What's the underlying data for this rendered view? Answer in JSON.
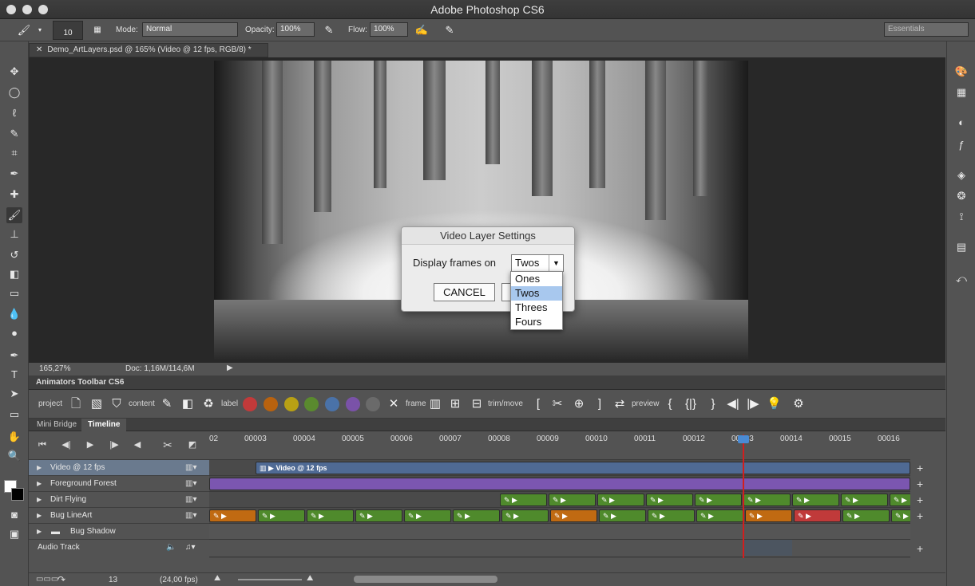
{
  "window": {
    "title": "Adobe Photoshop CS6"
  },
  "options": {
    "brush_size": "10",
    "mode_label": "Mode:",
    "mode_value": "Normal",
    "opacity_label": "Opacity:",
    "opacity_value": "100%",
    "flow_label": "Flow:",
    "flow_value": "100%",
    "workspace": "Essentials"
  },
  "document": {
    "tab_label": "Demo_ArtLayers.psd @ 165% (Video @ 12 fps, RGB/8) *",
    "zoom": "165,27%",
    "doc_size": "Doc: 1,16M/114,6M"
  },
  "dialog": {
    "title": "Video Layer Settings",
    "label": "Display frames on",
    "selected": "Twos",
    "cancel_label": "CANCEL",
    "options": [
      "Ones",
      "Twos",
      "Threes",
      "Fours"
    ]
  },
  "animators_toolbar": {
    "title": "Animators Toolbar CS6",
    "project_label": "project",
    "content_label": "content",
    "label_label": "label",
    "frame_label": "frame",
    "trim_label": "trim/move",
    "preview_label": "preview",
    "label_colors": [
      "#c23a3a",
      "#b8620f",
      "#b8a014",
      "#5a8a2e",
      "#4a72a8",
      "#7a52a8",
      "#6a6a6a"
    ]
  },
  "panels": {
    "tab1": "Mini Bridge",
    "tab2": "Timeline"
  },
  "timeline": {
    "ticks": [
      "02",
      "00003",
      "00004",
      "00005",
      "00006",
      "00007",
      "00008",
      "00009",
      "00010",
      "00011",
      "00012",
      "00013",
      "00014",
      "00015",
      "00016"
    ],
    "current_frame": "13",
    "fps": "(24,00 fps)",
    "video_clip_label": "Video @ 12 fps",
    "layers": [
      {
        "name": "Video @ 12 fps"
      },
      {
        "name": "Foreground Forest"
      },
      {
        "name": "Dirt Flying"
      },
      {
        "name": "Bug LineArt"
      },
      {
        "name": "Bug Shadow"
      },
      {
        "name": "Audio Track"
      }
    ]
  }
}
